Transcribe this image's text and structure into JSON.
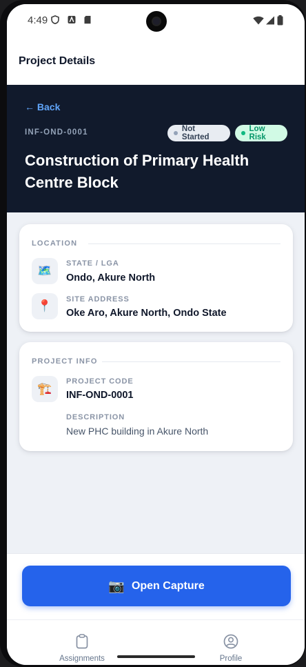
{
  "status_bar": {
    "time": "4:49"
  },
  "header": {
    "title": "Project Details"
  },
  "hero": {
    "back_label": "← Back",
    "project_code": "INF-OND-0001",
    "status_badge": "Not Started",
    "risk_badge": "Low Risk",
    "title": "Construction of Primary Health Centre Block",
    "colors": {
      "status": "#94a3b8",
      "risk": "#10b981",
      "background": "#111a2c"
    }
  },
  "location": {
    "section_label": "LOCATION",
    "state_lga_label": "STATE / LGA",
    "state_lga_value": "Ondo, Akure North",
    "state_icon": "map-icon",
    "site_address_label": "SITE ADDRESS",
    "site_address_value": "Oke Aro, Akure North, Ondo State",
    "address_icon": "pin-icon"
  },
  "project_info": {
    "section_label": "PROJECT INFO",
    "code_label": "PROJECT CODE",
    "code_value": "INF-OND-0001",
    "code_icon": "construction-crane-icon",
    "description_label": "DESCRIPTION",
    "description_value": "New PHC building in Akure North"
  },
  "actions": {
    "open_capture_label": "Open Capture",
    "open_capture_icon": "camera-icon",
    "accent": "#2563eb"
  },
  "tabs": [
    {
      "label": "Assignments",
      "icon": "clipboard-icon"
    },
    {
      "label": "Profile",
      "icon": "user-circle-icon"
    }
  ]
}
